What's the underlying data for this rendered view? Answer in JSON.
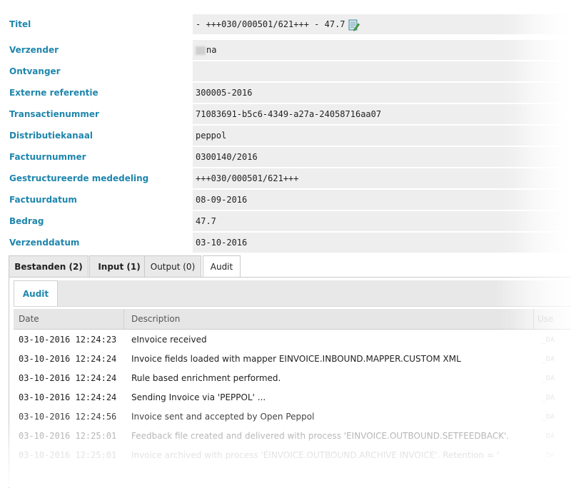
{
  "properties": [
    {
      "label": "Titel",
      "value": "- +++030/000501/621+++ - 47.7",
      "has_icon": true
    },
    {
      "label": "Verzender",
      "value": "na",
      "redacted": true
    },
    {
      "label": "Ontvanger",
      "value": ""
    },
    {
      "label": "Externe referentie",
      "value": "300005-2016"
    },
    {
      "label": "Transactienummer",
      "value": "71083691-b5c6-4349-a27a-24058716aa07"
    },
    {
      "label": "Distributiekanaal",
      "value": "peppol"
    },
    {
      "label": "Factuurnummer",
      "value": "0300140/2016"
    },
    {
      "label": "Gestructureerde mededeling",
      "value": "+++030/000501/621+++"
    },
    {
      "label": "Factuurdatum",
      "value": "08-09-2016"
    },
    {
      "label": "Bedrag",
      "value": "47.7"
    },
    {
      "label": "Verzenddatum",
      "value": "03-10-2016"
    }
  ],
  "icons": {
    "title_icon": "document-edit-icon"
  },
  "tabs": [
    {
      "label": "Bestanden (2)",
      "bold": true
    },
    {
      "label": "Input (1)",
      "bold": true
    },
    {
      "label": "Output (0)",
      "bold": false
    },
    {
      "label": "Audit",
      "bold": false,
      "active": true
    }
  ],
  "audit": {
    "subtab_label": "Audit",
    "columns": [
      "Date",
      "Description",
      "Use"
    ],
    "rows": [
      {
        "date": "03-10-2016 12:24:23",
        "description": "eInvoice received",
        "user": "_DA"
      },
      {
        "date": "03-10-2016 12:24:24",
        "description": "Invoice fields loaded with mapper EINVOICE.INBOUND.MAPPER.CUSTOM XML",
        "user": "_DA"
      },
      {
        "date": "03-10-2016 12:24:24",
        "description": "Rule based enrichment performed.",
        "user": "_DA"
      },
      {
        "date": "03-10-2016 12:24:24",
        "description": "Sending Invoice via 'PEPPOL' ...",
        "user": "_DA"
      },
      {
        "date": "03-10-2016 12:24:56",
        "description": "Invoice sent and accepted by Open Peppol",
        "user": "_DA"
      },
      {
        "date": "03-10-2016 12:25:01",
        "description": "Feedback file created and delivered with process 'EINVOICE.OUTBOUND.SETFEEDBACK'.",
        "user": "_DA"
      },
      {
        "date": "03-10-2016 12:25:01",
        "description": "Invoice archived with process 'EINVOICE.OUTBOUND.ARCHIVE INVOICE'. Retention = '",
        "user": "_DA"
      }
    ]
  },
  "colors": {
    "label": "#1f86ad",
    "field_bg": "#eeeeee",
    "tab_bg": "#e9e9e9"
  }
}
